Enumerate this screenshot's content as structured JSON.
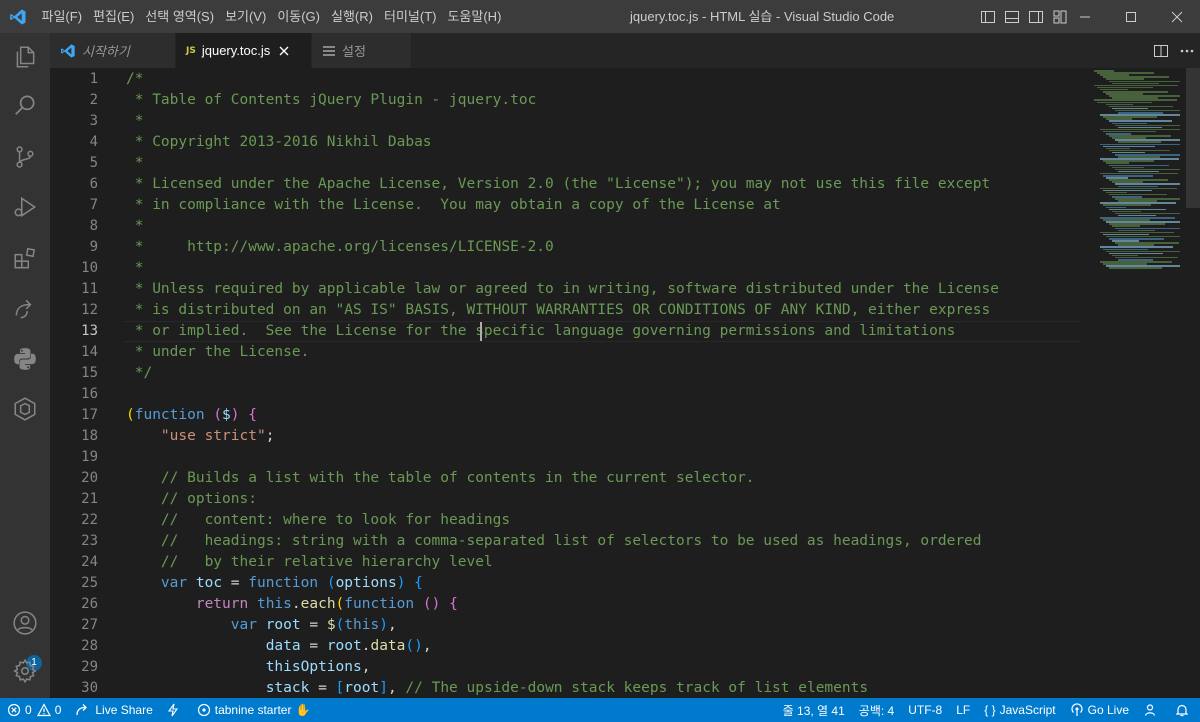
{
  "titlebar": {
    "menu": [
      "파일(F)",
      "편집(E)",
      "선택 영역(S)",
      "보기(V)",
      "이동(G)",
      "실행(R)",
      "터미널(T)",
      "도움말(H)"
    ],
    "window_title": "jquery.toc.js - HTML 실습 - Visual Studio Code"
  },
  "activitybar": {
    "icons": [
      "explorer-icon",
      "search-icon",
      "source-control-icon",
      "run-debug-icon",
      "extensions-icon",
      "live-share-icon",
      "python-icon",
      "remote-explorer-icon",
      "accounts-icon",
      "settings-gear-icon"
    ],
    "accounts_badge": "1"
  },
  "tabs": [
    {
      "label": "시작하기",
      "icon": "vscode-logo-icon",
      "active": false
    },
    {
      "label": "jquery.toc.js",
      "icon": "JS",
      "active": true
    },
    {
      "label": "설정",
      "icon": "settings-list-icon",
      "active": false
    }
  ],
  "editor": {
    "active_line": 13,
    "lines": [
      [
        [
          "/*",
          "cm"
        ]
      ],
      [
        [
          " * Table of Contents jQuery Plugin - jquery.toc",
          "cm"
        ]
      ],
      [
        [
          " *",
          "cm"
        ]
      ],
      [
        [
          " * Copyright 2013-2016 Nikhil Dabas",
          "cm"
        ]
      ],
      [
        [
          " *",
          "cm"
        ]
      ],
      [
        [
          " * Licensed under the Apache License, Version 2.0 (the \"License\"); you may not use this file except",
          "cm"
        ]
      ],
      [
        [
          " * in compliance with the License.  You may obtain a copy of the License at",
          "cm"
        ]
      ],
      [
        [
          " *",
          "cm"
        ]
      ],
      [
        [
          " *     http://www.apache.org/licenses/LICENSE-2.0",
          "cm"
        ]
      ],
      [
        [
          " *",
          "cm"
        ]
      ],
      [
        [
          " * Unless required by applicable law or agreed to in writing, software distributed under the License",
          "cm"
        ]
      ],
      [
        [
          " * is distributed on an \"AS IS\" BASIS, WITHOUT WARRANTIES OR CONDITIONS OF ANY KIND, either express",
          "cm"
        ]
      ],
      [
        [
          " * or implied.  See the License for the specific language governing permissions and limitations",
          "cm"
        ]
      ],
      [
        [
          " * under the License.",
          "cm"
        ]
      ],
      [
        [
          " */",
          "cm"
        ]
      ],
      [],
      [
        [
          "(",
          "p1"
        ],
        [
          "function",
          "kw"
        ],
        [
          " ",
          "pl"
        ],
        [
          "(",
          "p2"
        ],
        [
          "$",
          "id"
        ],
        [
          ")",
          "p2"
        ],
        [
          " ",
          "pl"
        ],
        [
          "{",
          "p2"
        ]
      ],
      [
        [
          "    ",
          "pl"
        ],
        [
          "\"use strict\"",
          "str"
        ],
        [
          ";",
          "pl"
        ]
      ],
      [],
      [
        [
          "    // Builds a list with the table of contents in the current selector.",
          "cm"
        ]
      ],
      [
        [
          "    // options:",
          "cm"
        ]
      ],
      [
        [
          "    //   content: where to look for headings",
          "cm"
        ]
      ],
      [
        [
          "    //   headings: string with a comma-separated list of selectors to be used as headings, ordered",
          "cm"
        ]
      ],
      [
        [
          "    //   by their relative hierarchy level",
          "cm"
        ]
      ],
      [
        [
          "    ",
          "pl"
        ],
        [
          "var",
          "kw"
        ],
        [
          " ",
          "pl"
        ],
        [
          "toc",
          "id"
        ],
        [
          " = ",
          "pl"
        ],
        [
          "function",
          "kw"
        ],
        [
          " ",
          "pl"
        ],
        [
          "(",
          "p3"
        ],
        [
          "options",
          "id"
        ],
        [
          ")",
          "p3"
        ],
        [
          " ",
          "pl"
        ],
        [
          "{",
          "p3"
        ]
      ],
      [
        [
          "        ",
          "pl"
        ],
        [
          "return",
          "ctl"
        ],
        [
          " ",
          "pl"
        ],
        [
          "this",
          "kw"
        ],
        [
          ".",
          "pl"
        ],
        [
          "each",
          "fn"
        ],
        [
          "(",
          "p1"
        ],
        [
          "function",
          "kw"
        ],
        [
          " ",
          "pl"
        ],
        [
          "(",
          "p2"
        ],
        [
          ")",
          "p2"
        ],
        [
          " ",
          "pl"
        ],
        [
          "{",
          "p2"
        ]
      ],
      [
        [
          "            ",
          "pl"
        ],
        [
          "var",
          "kw"
        ],
        [
          " ",
          "pl"
        ],
        [
          "root",
          "id"
        ],
        [
          " = ",
          "pl"
        ],
        [
          "$",
          "fn"
        ],
        [
          "(",
          "p3"
        ],
        [
          "this",
          "kw"
        ],
        [
          ")",
          "p3"
        ],
        [
          ",",
          "pl"
        ]
      ],
      [
        [
          "                ",
          "pl"
        ],
        [
          "data",
          "id"
        ],
        [
          " = ",
          "pl"
        ],
        [
          "root",
          "id"
        ],
        [
          ".",
          "pl"
        ],
        [
          "data",
          "fn"
        ],
        [
          "(",
          "p3"
        ],
        [
          ")",
          "p3"
        ],
        [
          ",",
          "pl"
        ]
      ],
      [
        [
          "                ",
          "pl"
        ],
        [
          "thisOptions",
          "id"
        ],
        [
          ",",
          "pl"
        ]
      ],
      [
        [
          "                ",
          "pl"
        ],
        [
          "stack",
          "id"
        ],
        [
          " = ",
          "pl"
        ],
        [
          "[",
          "p3"
        ],
        [
          "root",
          "id"
        ],
        [
          "]",
          "p3"
        ],
        [
          ", ",
          "pl"
        ],
        [
          "// The upside-down stack keeps track of list elements",
          "cm"
        ]
      ]
    ]
  },
  "statusbar": {
    "errors": "0",
    "warnings": "0",
    "live_share": "Live Share",
    "tabnine": "tabnine starter",
    "cursor_pos": "줄 13, 열 41",
    "spaces": "공백: 4",
    "encoding": "UTF-8",
    "eol": "LF",
    "language": "JavaScript",
    "go_live": "Go Live"
  }
}
